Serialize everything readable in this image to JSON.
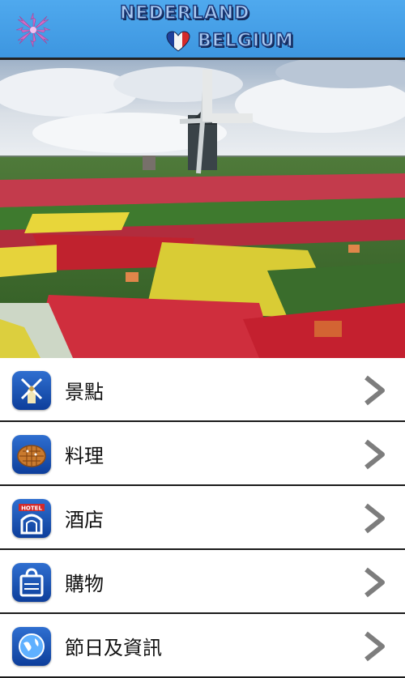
{
  "header": {
    "title_line1": "NEDERLAND",
    "title_line2": "BELGIUM",
    "accent_color": "#3d96e0"
  },
  "hero": {
    "icon": "windmill-tulip-field-photo"
  },
  "menu": {
    "items": [
      {
        "label": "景點",
        "icon": "windmill-icon"
      },
      {
        "label": "料理",
        "icon": "waffle-icon"
      },
      {
        "label": "酒店",
        "icon": "hotel-icon"
      },
      {
        "label": "購物",
        "icon": "shopping-bag-icon"
      },
      {
        "label": "節日及資訊",
        "icon": "globe-icon"
      }
    ]
  }
}
